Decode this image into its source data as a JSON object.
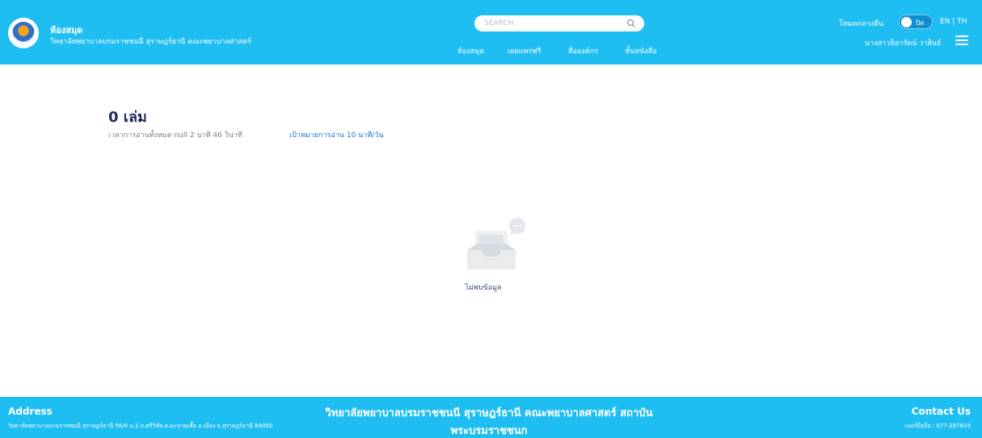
{
  "header": {
    "brand_title": "ห้องสมุด",
    "brand_subtitle": "วิทยาลัยพยาบาลบรมราชชนนี สุราษฎร์ธานี คณะพยาบาลศาสตร์",
    "search_placeholder": "SEARCH",
    "nav": [
      "ห้องสมุด",
      "เผยแพร่ฟรี",
      "สื่อองค์กร",
      "ชั้นหนังสือ"
    ],
    "night_mode_label": "โหมดกลางคืน",
    "toggle_text": "ปิด",
    "language": "EN | TH",
    "user_name": "นางสาวธิดารัตน์ วาสินธ์"
  },
  "main": {
    "book_count": "0 เล่ม",
    "read_time": "เวลาการอ่านทั้งหมด null 2 นาที 46 วินาที",
    "reading_goal": "เป้าหมายการอ่าน 10 นาที/วัน",
    "empty_message": "ไม่พบข้อมูล"
  },
  "footer": {
    "address_title": "Address",
    "address": "วิทยาลัยพยาบาลบรมราชชนนี สุราษฎร์ธานี 56/6 ม.2 ถ.ศรีวิชัย ต.มะขามเตี้ย อ.เมือง จ.สุราษฎร์ธานี 84000",
    "center_title": "วิทยาลัยพยาบาลบรมราชชนนี สุราษฎร์ธานี คณะพยาบาลศาสตร์ สถาบันพระบรมราชชนก",
    "contact_title": "Contact Us",
    "phone": "เบอร์มือถือ : 077-287819"
  },
  "colors": {
    "header_bg": "#1fbef2",
    "footer_bg": "#1fbef2",
    "title_text": "#1d2a5a",
    "link": "#1a73d9"
  }
}
